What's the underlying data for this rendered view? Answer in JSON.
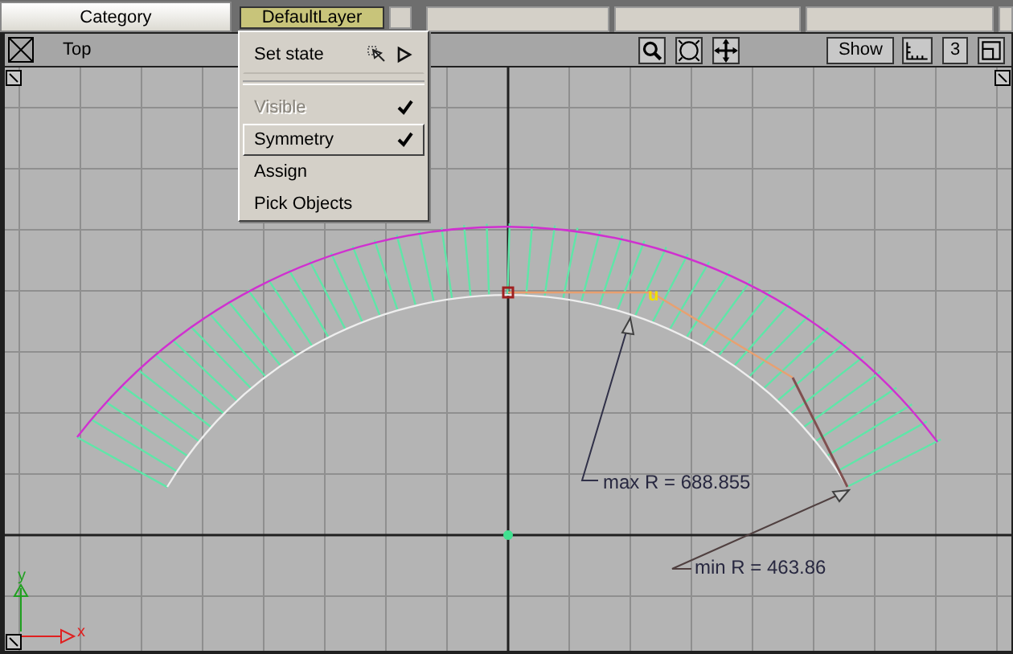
{
  "top_bar": {
    "category_tab": "Category",
    "layer_button": "DefaultLayer"
  },
  "viewport": {
    "view_label": "Top",
    "show_button": "Show",
    "layout_number": "3"
  },
  "layer_menu": {
    "items": [
      {
        "kind": "submenu",
        "label": "Set state",
        "disabled": false,
        "checked": false,
        "selected": false
      },
      {
        "kind": "separator"
      },
      {
        "kind": "toggle",
        "label": "Visible",
        "disabled": true,
        "checked": true,
        "selected": false
      },
      {
        "kind": "toggle",
        "label": "Symmetry",
        "disabled": false,
        "checked": true,
        "selected": true
      },
      {
        "kind": "action",
        "label": "Assign",
        "disabled": false,
        "checked": false,
        "selected": false
      },
      {
        "kind": "action",
        "label": "Pick Objects",
        "disabled": false,
        "checked": false,
        "selected": false
      }
    ]
  },
  "canvas": {
    "marker_label": "u",
    "annotations": [
      {
        "text": "max R = 688.855"
      },
      {
        "text": "min R = 463.86"
      }
    ],
    "axis_x_label": "x",
    "axis_y_label": "y"
  }
}
